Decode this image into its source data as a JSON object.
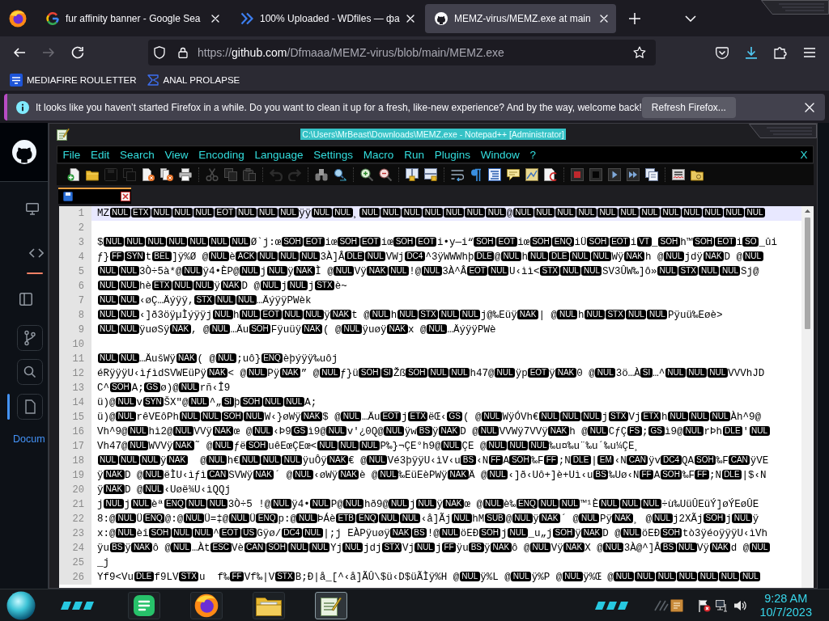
{
  "browser_tabs": [
    {
      "title": "fur affinity banner - Google Sea",
      "kind": "google",
      "selected": false
    },
    {
      "title": "100% Uploaded - WDfiles — фа",
      "kind": "chevrons",
      "selected": false
    },
    {
      "title": "MEMZ-virus/MEMZ.exe at main",
      "kind": "cat",
      "selected": true
    }
  ],
  "nav_buttons": [
    {
      "kind": "back",
      "disabled": false
    },
    {
      "kind": "forward",
      "disabled": true
    },
    {
      "kind": "reload",
      "disabled": false
    }
  ],
  "address_bar": {
    "scheme": "https://",
    "host": "github.com",
    "path": "/Dfmaaa/MEMZ-virus/blob/main/MEMZ.exe"
  },
  "bookmarks": [
    {
      "label": "MEDIAFIRE ROULETTER",
      "kind": "tile"
    },
    {
      "label": "ANAL PROLAPSE",
      "kind": "sigma"
    }
  ],
  "notification": {
    "message": "It looks like you haven’t started Firefox in a while. Do you want to clean it up for a fresh, like-new experience? And by the way, welcome back!",
    "button": "Refresh Firefox..."
  },
  "github_sidebar": {
    "link": "Docum"
  },
  "notepad": {
    "title": "C:\\Users\\MrBeast\\Downloads\\MEMZ.exe - Notepad++ [Administrator]",
    "menu": [
      "File",
      "Edit",
      "Search",
      "View",
      "Encoding",
      "Language",
      "Settings",
      "Macro",
      "Run",
      "Plugins",
      "Window",
      "?"
    ],
    "close_label": "X",
    "tabs": [
      {
        "selected": true
      }
    ],
    "lines": [
      {
        "number": "1",
        "current": true,
        "segments": [
          {
            "text": "MZ",
            "ctrl": "NUL"
          },
          {
            "ctrl": "ETX"
          },
          {
            "ctrl": "NUL"
          },
          {
            "ctrl": "NUL"
          },
          {
            "ctrl": "NUL"
          },
          {
            "ctrl": "EOT"
          },
          {
            "ctrl": "NUL"
          },
          {
            "ctrl": "NUL"
          },
          {
            "ctrl": "NUL"
          },
          {
            "text": "ÿÿ",
            "ctrl": "NUL"
          },
          {
            "ctrl": "NUL"
          },
          {
            "text": "¸",
            "ctrl": "NUL"
          },
          {
            "ctrl": "NUL"
          },
          {
            "ctrl": "NUL"
          },
          {
            "ctrl": "NUL"
          },
          {
            "ctrl": "NUL"
          },
          {
            "ctrl": "NUL"
          },
          {
            "ctrl": "NUL"
          },
          {
            "text": "@",
            "ctrl": "NUL"
          },
          {
            "ctrl": "NUL"
          },
          {
            "ctrl": "NUL"
          },
          {
            "ctrl": "NUL"
          },
          {
            "ctrl": "NUL"
          },
          {
            "ctrl": "NUL"
          },
          {
            "ctrl": "NUL"
          },
          {
            "ctrl": "NUL"
          },
          {
            "ctrl": "NUL"
          },
          {
            "ctrl": "NUL"
          },
          {
            "ctrl": "NUL"
          },
          {
            "ctrl": "NUL"
          }
        ]
      },
      {
        "number": "2",
        "current": false
      },
      {
        "number": "3",
        "current": false,
        "segments": [
          {
            "text": "$",
            "ctrl": "NUL"
          },
          {
            "ctrl": "NUL"
          },
          {
            "ctrl": "NUL"
          },
          {
            "ctrl": "NUL"
          },
          {
            "ctrl": "NUL"
          },
          {
            "ctrl": "NUL"
          },
          {
            "ctrl": "NUL"
          },
          {
            "text": "Ø`j:œ",
            "ctrl": "SOH"
          },
          {
            "ctrl": "EOT"
          },
          {
            "text": "iœ",
            "ctrl": "SOH"
          },
          {
            "ctrl": "EOT"
          },
          {
            "text": "iœ",
            "ctrl": "SOH"
          },
          {
            "ctrl": "EOT"
          },
          {
            "text": "i•y—i“",
            "ctrl": "SOH"
          },
          {
            "ctrl": "EOT"
          },
          {
            "text": "iœ",
            "ctrl": "SOH"
          },
          {
            "ctrl": "ENQ"
          },
          {
            "text": "iÜ",
            "ctrl": "SOH"
          },
          {
            "ctrl": "EOT"
          },
          {
            "text": "i",
            "ctrl": "VT"
          },
          {
            "text": "_",
            "ctrl": "SOH"
          },
          {
            "text": "h™",
            "ctrl": "SOH"
          },
          {
            "ctrl": "EOT"
          },
          {
            "text": "i",
            "ctrl": "SO"
          },
          {
            "text": "_ûi"
          }
        ]
      },
      {
        "number": "4",
        "current": false,
        "segments": [
          {
            "text": "ƒ}",
            "ctrl": "FF"
          },
          {
            "ctrl": "SYN"
          },
          {
            "text": "t",
            "ctrl": "BEL"
          },
          {
            "text": "]ÿ%Ø @",
            "ctrl": "NUL"
          },
          {
            "text": "è",
            "ctrl": "ACK"
          },
          {
            "ctrl": "NUL"
          },
          {
            "ctrl": "NUL"
          },
          {
            "ctrl": "NUL"
          },
          {
            "text": "3À]Â",
            "ctrl": "DLE"
          },
          {
            "ctrl": "NUL"
          },
          {
            "text": "VWj",
            "ctrl": "DC4"
          },
          {
            "text": "^3ÿWWWhþ",
            "ctrl": "DLE"
          },
          {
            "text": "@",
            "ctrl": "NUL"
          },
          {
            "text": "h",
            "ctrl": "NUL"
          },
          {
            "ctrl": "DLE"
          },
          {
            "ctrl": "NUL"
          },
          {
            "ctrl": "NUL"
          },
          {
            "text": "Wÿ",
            "ctrl": "NAK"
          },
          {
            "text": "h @",
            "ctrl": "NUL"
          },
          {
            "text": "jdÿ",
            "ctrl": "NAK"
          },
          {
            "text": "D @",
            "ctrl": "NUL"
          }
        ]
      },
      {
        "number": "5",
        "current": false,
        "segments": [
          {
            "ctrl": "NUL"
          },
          {
            "ctrl": "NUL"
          },
          {
            "text": "3Ò÷5à*@",
            "ctrl": "NUL"
          },
          {
            "text": "ÿ4•ÈP@",
            "ctrl": "NUL"
          },
          {
            "text": "j",
            "ctrl": "NUL"
          },
          {
            "text": "ÿ",
            "ctrl": "NAK"
          },
          {
            "text": "Ì @",
            "ctrl": "NUL"
          },
          {
            "text": "Vÿ",
            "ctrl": "NAK"
          },
          {
            "ctrl": "NUL"
          },
          {
            "text": "!@",
            "ctrl": "NUL"
          },
          {
            "text": "3À^Â",
            "ctrl": "EOT"
          },
          {
            "ctrl": "NUL"
          },
          {
            "text": "U‹ìì<",
            "ctrl": "STX"
          },
          {
            "ctrl": "NUL"
          },
          {
            "ctrl": "NUL"
          },
          {
            "text": "SV3ÛW‰]ô»",
            "ctrl": "NUL"
          },
          {
            "ctrl": "STX"
          },
          {
            "ctrl": "NUL"
          },
          {
            "ctrl": "NUL"
          },
          {
            "text": "Sj@"
          }
        ]
      },
      {
        "number": "6",
        "current": false,
        "segments": [
          {
            "ctrl": "NUL"
          },
          {
            "ctrl": "NUL"
          },
          {
            "text": "hè",
            "ctrl": "ETX"
          },
          {
            "ctrl": "NUL"
          },
          {
            "ctrl": "NUL"
          },
          {
            "text": "ÿ",
            "ctrl": "NAK"
          },
          {
            "text": "D @",
            "ctrl": "NUL"
          },
          {
            "text": "j",
            "ctrl": "NUL"
          },
          {
            "text": "j",
            "ctrl": "STX"
          },
          {
            "text": "è~"
          }
        ]
      },
      {
        "number": "7",
        "current": false,
        "segments": [
          {
            "ctrl": "NUL"
          },
          {
            "ctrl": "NUL"
          },
          {
            "text": "‹øÇ…Äýÿÿ,",
            "ctrl": "STX"
          },
          {
            "ctrl": "NUL"
          },
          {
            "ctrl": "NUL"
          },
          {
            "text": "…ÄýÿÿPWèk"
          }
        ]
      },
      {
        "number": "8",
        "current": false,
        "segments": [
          {
            "ctrl": "NUL"
          },
          {
            "ctrl": "NUL"
          },
          {
            "text": "‹]ð3öÿµÌýÿÿj",
            "ctrl": "NUL"
          },
          {
            "text": "h",
            "ctrl": "NUL"
          },
          {
            "ctrl": "EOT"
          },
          {
            "ctrl": "NUL"
          },
          {
            "ctrl": "NUL"
          },
          {
            "text": "ÿ",
            "ctrl": "NAK"
          },
          {
            "text": "t @",
            "ctrl": "NUL"
          },
          {
            "text": "h",
            "ctrl": "NUL"
          },
          {
            "ctrl": "STX"
          },
          {
            "ctrl": "NUL"
          },
          {
            "ctrl": "NUL"
          },
          {
            "text": "j@‰Eüÿ",
            "ctrl": "NAK"
          },
          {
            "text": "| @",
            "ctrl": "NUL"
          },
          {
            "text": "h",
            "ctrl": "NUL"
          },
          {
            "ctrl": "STX"
          },
          {
            "ctrl": "NUL"
          },
          {
            "ctrl": "NUL"
          },
          {
            "text": "Pÿuü‰Eøè>"
          }
        ]
      },
      {
        "number": "9",
        "current": false,
        "segments": [
          {
            "ctrl": "NUL"
          },
          {
            "ctrl": "NUL"
          },
          {
            "text": "ÿuøSÿ",
            "ctrl": "NAK"
          },
          {
            "text": ", @",
            "ctrl": "NUL"
          },
          {
            "text": "…Äu",
            "ctrl": "SOH"
          },
          {
            "text": "Fÿuüÿ",
            "ctrl": "NAK"
          },
          {
            "text": "( @",
            "ctrl": "NUL"
          },
          {
            "text": "ÿuøÿ",
            "ctrl": "NAK"
          },
          {
            "text": "x @",
            "ctrl": "NUL"
          },
          {
            "text": "…ÄýÿÿPWè"
          }
        ]
      },
      {
        "number": "10",
        "current": false
      },
      {
        "number": "11",
        "current": false,
        "segments": [
          {
            "ctrl": "NUL"
          },
          {
            "ctrl": "NUL"
          },
          {
            "text": "…ÄušWÿ",
            "ctrl": "NAK"
          },
          {
            "text": "( @",
            "ctrl": "NUL"
          },
          {
            "text": ";uô}",
            "ctrl": "ENQ"
          },
          {
            "text": "èþýÿÿ‰uôj"
          }
        ]
      },
      {
        "number": "12",
        "current": false,
        "segments": [
          {
            "text": "éRÿÿÿU‹ìƒìdSVWEüPÿ",
            "ctrl": "NAK"
          },
          {
            "text": "< @",
            "ctrl": "NUL"
          },
          {
            "text": "Pÿ",
            "ctrl": "NAK"
          },
          {
            "text": "” @",
            "ctrl": "NUL"
          },
          {
            "text": "ƒ}ü",
            "ctrl": "SOH"
          },
          {
            "ctrl": "SI"
          },
          {
            "text": "Žß",
            "ctrl": "SOH"
          },
          {
            "ctrl": "NUL"
          },
          {
            "ctrl": "NUL"
          },
          {
            "text": "h47@",
            "ctrl": "NUL"
          },
          {
            "text": "ÿp",
            "ctrl": "EOT"
          },
          {
            "text": "ÿ",
            "ctrl": "NAK"
          },
          {
            "text": "0 @",
            "ctrl": "NUL"
          },
          {
            "text": "3ö…À",
            "ctrl": "SI"
          },
          {
            "text": "…^",
            "ctrl": "NUL"
          },
          {
            "ctrl": "NUL"
          },
          {
            "ctrl": "NUL"
          },
          {
            "text": "VVVhJD"
          }
        ]
      },
      {
        "number": "13",
        "current": false,
        "segments": [
          {
            "text": "C^",
            "ctrl": "SOH"
          },
          {
            "text": "A;",
            "ctrl": "GS"
          },
          {
            "text": "ø)@",
            "ctrl": "NUL"
          },
          {
            "text": "rñ‹Î9"
          }
        ]
      },
      {
        "number": "14",
        "current": false,
        "segments": [
          {
            "text": "ü)@",
            "ctrl": "NUL"
          },
          {
            "text": "v",
            "ctrl": "SYN"
          },
          {
            "text": "ŠX\"@",
            "ctrl": "NUL"
          },
          {
            "text": "^„",
            "ctrl": "SI"
          },
          {
            "text": "þ",
            "ctrl": "SOH"
          },
          {
            "ctrl": "NUL"
          },
          {
            "ctrl": "NUL"
          },
          {
            "text": "A;"
          }
        ]
      },
      {
        "number": "15",
        "current": false,
        "segments": [
          {
            "text": "ü)@",
            "ctrl": "NUL"
          },
          {
            "text": "rêVEôPh",
            "ctrl": "NUL"
          },
          {
            "ctrl": "NUL"
          },
          {
            "ctrl": "SOH"
          },
          {
            "ctrl": "NUL"
          },
          {
            "text": "W‹}øWÿ",
            "ctrl": "NAK"
          },
          {
            "text": "$ @",
            "ctrl": "NUL"
          },
          {
            "text": "…Äu",
            "ctrl": "EOT"
          },
          {
            "text": "j",
            "ctrl": "ETX"
          },
          {
            "text": "ëŒ‹",
            "ctrl": "GS"
          },
          {
            "text": "( @",
            "ctrl": "NUL"
          },
          {
            "text": "WÿÓVh€",
            "ctrl": "NUL"
          },
          {
            "ctrl": "NUL"
          },
          {
            "ctrl": "NUL"
          },
          {
            "text": "j",
            "ctrl": "STX"
          },
          {
            "text": "Vj",
            "ctrl": "ETX"
          },
          {
            "text": "h",
            "ctrl": "NUL"
          },
          {
            "ctrl": "NUL"
          },
          {
            "ctrl": "NUL"
          },
          {
            "text": "Àh^9@"
          }
        ]
      },
      {
        "number": "16",
        "current": false,
        "segments": [
          {
            "text": "Vh^9@",
            "ctrl": "NUL"
          },
          {
            "text": "hì2@",
            "ctrl": "NUL"
          },
          {
            "text": "VVÿ",
            "ctrl": "NAK"
          },
          {
            "text": "œ @",
            "ctrl": "NUL"
          },
          {
            "text": "‹Þ9",
            "ctrl": "GS"
          },
          {
            "text": "ì9@",
            "ctrl": "NUL"
          },
          {
            "text": "v'¿0Q@",
            "ctrl": "NUL"
          },
          {
            "text": "ÿw",
            "ctrl": "BS"
          },
          {
            "text": "ÿ",
            "ctrl": "NAK"
          },
          {
            "text": "D @",
            "ctrl": "NUL"
          },
          {
            "text": "VVWÿ7VVÿ",
            "ctrl": "NAK"
          },
          {
            "text": "h @",
            "ctrl": "NUL"
          },
          {
            "text": "CƒÇ",
            "ctrl": "FS"
          },
          {
            "text": ";",
            "ctrl": "GS"
          },
          {
            "text": "ì9@",
            "ctrl": "NUL"
          },
          {
            "text": "rÞh",
            "ctrl": "DLE"
          },
          {
            "text": "'",
            "ctrl": "NUL"
          }
        ]
      },
      {
        "number": "17",
        "current": false,
        "segments": [
          {
            "text": "Vh47@",
            "ctrl": "NUL"
          },
          {
            "text": "WVVÿ",
            "ctrl": "NAK"
          },
          {
            "text": "˜ @",
            "ctrl": "NUL"
          },
          {
            "text": "ƒë",
            "ctrl": "SOH"
          },
          {
            "text": "uêEœÇEœ<",
            "ctrl": "NUL"
          },
          {
            "ctrl": "NUL"
          },
          {
            "ctrl": "NUL"
          },
          {
            "text": "P‰}¬ÇE°h9@",
            "ctrl": "NUL"
          },
          {
            "text": "ÇE @",
            "ctrl": "NUL"
          },
          {
            "ctrl": "NUL"
          },
          {
            "ctrl": "NUL"
          },
          {
            "text": "‰u¤‰u¨‰u´‰u¼ÇE¸"
          }
        ]
      },
      {
        "number": "18",
        "current": false,
        "segments": [
          {
            "ctrl": "NUL"
          },
          {
            "ctrl": "NUL"
          },
          {
            "ctrl": "NUL"
          },
          {
            "text": "ÿ",
            "ctrl": "NAK"
          },
          {
            "text": "  @",
            "ctrl": "NUL"
          },
          {
            "text": "h€",
            "ctrl": "NUL"
          },
          {
            "ctrl": "NUL"
          },
          {
            "ctrl": "NUL"
          },
          {
            "text": "ÿuÔÿ",
            "ctrl": "NAK"
          },
          {
            "text": "€ @",
            "ctrl": "NUL"
          },
          {
            "text": "Vé3þÿÿU‹ìV‹u",
            "ctrl": "BS"
          },
          {
            "text": "‹N",
            "ctrl": "FF"
          },
          {
            "text": "A",
            "ctrl": "SOH"
          },
          {
            "text": "‰F",
            "ctrl": "FF"
          },
          {
            "text": ";N",
            "ctrl": "DLE"
          },
          {
            "text": "|",
            "ctrl": "EM"
          },
          {
            "text": "‹N",
            "ctrl": "CAN"
          },
          {
            "text": "ÿv",
            "ctrl": "DC4"
          },
          {
            "text": "QA",
            "ctrl": "SOH"
          },
          {
            "text": "‰F",
            "ctrl": "CAN"
          },
          {
            "text": "ÿVE"
          }
        ]
      },
      {
        "number": "19",
        "current": false,
        "segments": [
          {
            "text": "ÿ",
            "ctrl": "NAK"
          },
          {
            "text": "D @",
            "ctrl": "NUL"
          },
          {
            "text": "ëÌU‹ìƒì",
            "ctrl": "CAN"
          },
          {
            "text": "SVWÿ",
            "ctrl": "NAK"
          },
          {
            "text": "´ @",
            "ctrl": "NUL"
          },
          {
            "text": "‹øWÿ",
            "ctrl": "NAK"
          },
          {
            "text": "è @",
            "ctrl": "NUL"
          },
          {
            "text": "‰EüEèPWÿ",
            "ctrl": "NAK"
          },
          {
            "text": "Ä @",
            "ctrl": "NUL"
          },
          {
            "text": "‹]ð‹Uô+]è+Uì‹u",
            "ctrl": "BS"
          },
          {
            "text": "‰Uø‹N",
            "ctrl": "FF"
          },
          {
            "text": "A",
            "ctrl": "SOH"
          },
          {
            "text": "‰F",
            "ctrl": "FF"
          },
          {
            "text": ";N",
            "ctrl": "DLE"
          },
          {
            "text": "|$‹N"
          }
        ]
      },
      {
        "number": "20",
        "current": false,
        "segments": [
          {
            "text": "ÿ",
            "ctrl": "NAK"
          },
          {
            "text": "D @",
            "ctrl": "NUL"
          },
          {
            "text": "‹Uøë¾U‹ìQQj"
          }
        ]
      },
      {
        "number": "21",
        "current": false,
        "segments": [
          {
            "text": "j",
            "ctrl": "NUL"
          },
          {
            "text": "j",
            "ctrl": "NUL"
          },
          {
            "text": "èª",
            "ctrl": "ENQ"
          },
          {
            "ctrl": "NUL"
          },
          {
            "ctrl": "NUL"
          },
          {
            "text": "3Ò÷5 !@",
            "ctrl": "NUL"
          },
          {
            "text": "ÿ4•",
            "ctrl": "NUL"
          },
          {
            "text": "P@",
            "ctrl": "NUL"
          },
          {
            "text": "hð9@",
            "ctrl": "NUL"
          },
          {
            "text": "j",
            "ctrl": "NUL"
          },
          {
            "text": "ÿ",
            "ctrl": "NAK"
          },
          {
            "text": "œ @",
            "ctrl": "NUL"
          },
          {
            "text": "è‰",
            "ctrl": "ENQ"
          },
          {
            "ctrl": "NUL"
          },
          {
            "ctrl": "NUL"
          },
          {
            "text": "™¹È",
            "ctrl": "NUL"
          },
          {
            "ctrl": "NUL"
          },
          {
            "ctrl": "NUL"
          },
          {
            "text": "÷ù‰UüÛEüÝ]øÝEøÛE"
          }
        ]
      },
      {
        "number": "22",
        "current": false,
        "segments": [
          {
            "text": "8:@",
            "ctrl": "NUL"
          },
          {
            "text": "Ü",
            "ctrl": "ENQ"
          },
          {
            "text": "@:@",
            "ctrl": "NUL"
          },
          {
            "text": "Ü=‡@",
            "ctrl": "NUL"
          },
          {
            "text": "Ü",
            "ctrl": "ENQ"
          },
          {
            "text": "p:@",
            "ctrl": "NUL"
          },
          {
            "text": "ÞÁè",
            "ctrl": "ETB"
          },
          {
            "ctrl": "ENQ"
          },
          {
            "ctrl": "NUL"
          },
          {
            "ctrl": "NUL"
          },
          {
            "text": "‹å]Ãj",
            "ctrl": "NUL"
          },
          {
            "text": "hM",
            "ctrl": "SUB"
          },
          {
            "text": "@",
            "ctrl": "NUL"
          },
          {
            "text": "ÿ",
            "ctrl": "NAK"
          },
          {
            "text": "´ @",
            "ctrl": "NUL"
          },
          {
            "text": "Pÿ",
            "ctrl": "NAK"
          },
          {
            "text": "¸ @",
            "ctrl": "NUL"
          },
          {
            "text": "j2XÃj",
            "ctrl": "SOH"
          },
          {
            "text": "j",
            "ctrl": "NUL"
          },
          {
            "text": "ÿ"
          }
        ]
      },
      {
        "number": "23",
        "current": false,
        "segments": [
          {
            "text": "x:@",
            "ctrl": "NUL"
          },
          {
            "text": "èî",
            "ctrl": "SOH"
          },
          {
            "ctrl": "NUL"
          },
          {
            "ctrl": "NUL"
          },
          {
            "text": "^",
            "ctrl": "EOT"
          },
          {
            "ctrl": "US"
          },
          {
            "text": "Gÿø/",
            "ctrl": "DC4"
          },
          {
            "ctrl": "NUL"
          },
          {
            "text": "|;j EÀPÿuøÿ",
            "ctrl": "NAK"
          },
          {
            "ctrl": "BS"
          },
          {
            "text": "!@",
            "ctrl": "NUL"
          },
          {
            "text": "öEÐ",
            "ctrl": "SOH"
          },
          {
            "text": "j",
            "ctrl": "NUL"
          },
          {
            "text": "_u„j",
            "ctrl": "SOH"
          },
          {
            "text": "ÿ",
            "ctrl": "NAK"
          },
          {
            "text": "D @",
            "ctrl": "NUL"
          },
          {
            "text": "öEÐ",
            "ctrl": "SOH"
          },
          {
            "text": "tò3ÿéoÿÿÿU‹ìVh"
          }
        ]
      },
      {
        "number": "24",
        "current": false,
        "segments": [
          {
            "text": "ÿu",
            "ctrl": "BS"
          },
          {
            "text": "ÿ",
            "ctrl": "NAK"
          },
          {
            "text": "ô @",
            "ctrl": "NUL"
          },
          {
            "text": "…Àt",
            "ctrl": "ESC"
          },
          {
            "text": "Vè",
            "ctrl": "CAN"
          },
          {
            "ctrl": "SOH"
          },
          {
            "ctrl": "NUL"
          },
          {
            "ctrl": "NUL"
          },
          {
            "text": "Yj",
            "ctrl": "NUL"
          },
          {
            "text": "jdj",
            "ctrl": "STX"
          },
          {
            "text": "Vj",
            "ctrl": "NUL"
          },
          {
            "text": "j",
            "ctrl": "FF"
          },
          {
            "text": "ÿu",
            "ctrl": "BS"
          },
          {
            "text": "ÿ",
            "ctrl": "NAK"
          },
          {
            "text": "ô @",
            "ctrl": "NUL"
          },
          {
            "text": "Vÿ",
            "ctrl": "NAK"
          },
          {
            "text": "X @",
            "ctrl": "NUL"
          },
          {
            "text": "3À@^]Â",
            "ctrl": "BS"
          },
          {
            "ctrl": "NUL"
          },
          {
            "text": "Vÿ",
            "ctrl": "NAK"
          },
          {
            "text": "d @",
            "ctrl": "NUL"
          }
        ]
      },
      {
        "number": "25",
        "current": false,
        "segments": [
          {
            "text": "_j"
          }
        ]
      },
      {
        "number": "26",
        "current": false,
        "segments": [
          {
            "text": "Yf9<Vu",
            "ctrl": "DLE"
          },
          {
            "text": "f9LV",
            "ctrl": "STX"
          },
          {
            "text": "u  f‰",
            "ctrl": "FF"
          },
          {
            "text": "Vf‰|V",
            "ctrl": "STX"
          },
          {
            "text": "B;Ð|å_[^‹å]ÃÛ\\$ü‹D$üÃÌÿ%H @",
            "ctrl": "NUL"
          },
          {
            "text": "ÿ%L @",
            "ctrl": "NUL"
          },
          {
            "text": "ÿ%P @",
            "ctrl": "NUL"
          },
          {
            "text": "ÿ%Œ @",
            "ctrl": "NUL"
          },
          {
            "ctrl": "NUL"
          },
          {
            "ctrl": "NUL"
          },
          {
            "ctrl": "NUL"
          },
          {
            "ctrl": "NUL"
          },
          {
            "ctrl": "NUL"
          },
          {
            "ctrl": "NUL"
          }
        ]
      }
    ]
  },
  "taskbar": {
    "apps": [
      {
        "kind": "lines",
        "selected": false
      },
      {
        "kind": "browser",
        "selected": false
      },
      {
        "kind": "folder",
        "selected": false
      },
      {
        "kind": "notepad",
        "selected": true
      }
    ],
    "time": "9:28 AM",
    "date": "10/7/2023"
  }
}
